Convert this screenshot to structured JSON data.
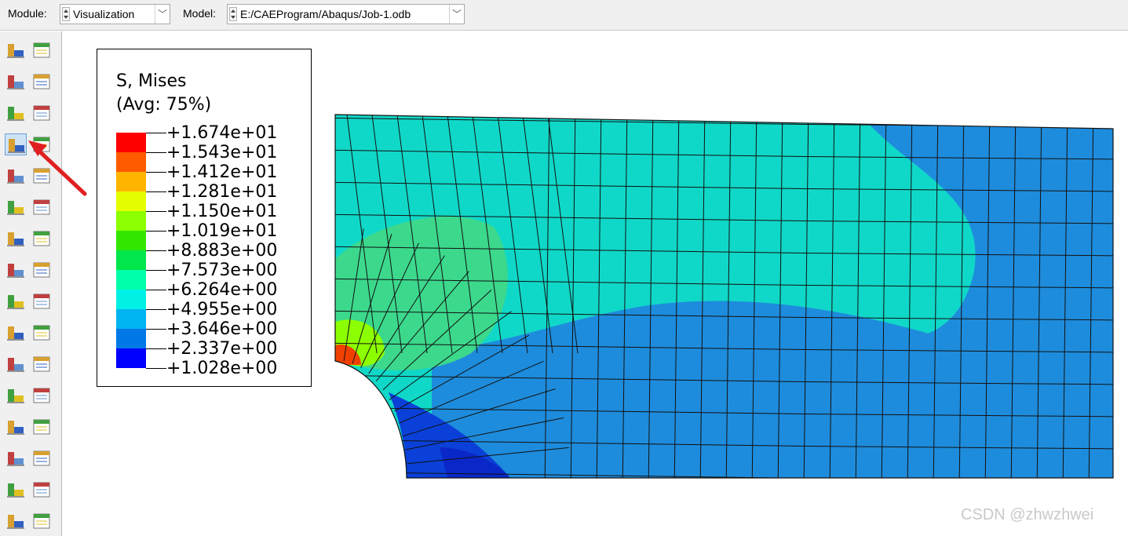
{
  "toolbar": {
    "module_label": "Module:",
    "module_value": "Visualization",
    "model_label": "Model:",
    "model_value": "E:/CAEProgram/Abaqus/Job-1.odb"
  },
  "toolbox": {
    "icons": [
      "odb-display-options-icon",
      "common-plot-options-icon",
      "plot-undeformed-shape-icon",
      "superimpose-options-icon",
      "plot-deformed-shape-icon",
      "deformed-shape-options-icon",
      "plot-contours-icon",
      "contour-options-icon",
      "plot-symbols-icon",
      "symbol-options-icon",
      "plot-material-orientations-icon",
      "orientation-options-icon",
      "allow-multiple-plot-states-icon",
      "overlay-plot-icon",
      "animate-scale-factor-icon",
      "animate-time-history-icon",
      "animate-harmonic-icon",
      "animation-options-icon",
      "create-xy-data-icon",
      "xy-data-manager-icon",
      "plot-xy-data-icon",
      "xy-plot-options-icon",
      "create-path-icon",
      "plot-path-icon",
      "view-cut-icon",
      "view-cut-manager-icon",
      "display-group-icon",
      "display-group-manager-icon",
      "free-body-cut-icon",
      "free-body-manager-icon",
      "stream-plot-icon",
      "stream-manager-icon"
    ],
    "selected": "plot-contours-icon"
  },
  "legend": {
    "title_line1": "S, Mises",
    "title_line2": "(Avg: 75%)",
    "values": [
      "+1.674e+01",
      "+1.543e+01",
      "+1.412e+01",
      "+1.281e+01",
      "+1.150e+01",
      "+1.019e+01",
      "+8.883e+00",
      "+7.573e+00",
      "+6.264e+00",
      "+4.955e+00",
      "+3.646e+00",
      "+2.337e+00",
      "+1.028e+00"
    ],
    "band_colors": [
      "#ff0000",
      "#ff5a00",
      "#ffb400",
      "#e6ff00",
      "#8cff00",
      "#32e600",
      "#00e64b",
      "#00ffaa",
      "#00f0e6",
      "#00b4f0",
      "#0078e6",
      "#0000ff"
    ]
  },
  "viewport": {
    "model_colors": {
      "low": "#1e8cdc",
      "mid": "#10d8c8",
      "high": "#3cd88c",
      "hot": "#f04000",
      "min": "#0a28c8",
      "mesh": "#111111"
    }
  },
  "watermark": "CSDN @zhwzhwei",
  "annotation_color": "#e02020"
}
